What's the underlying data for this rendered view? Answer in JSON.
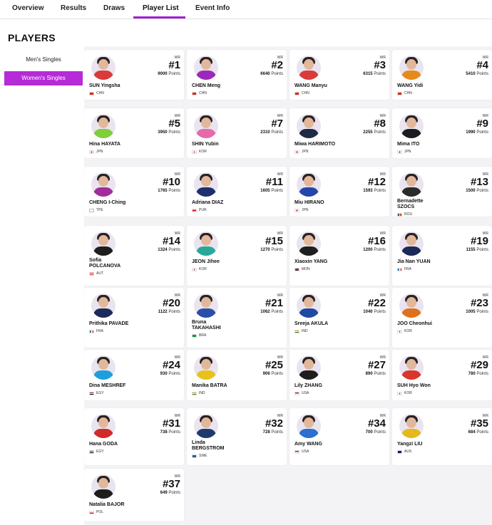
{
  "nav": {
    "tabs": [
      {
        "label": "Overview",
        "active": false
      },
      {
        "label": "Results",
        "active": false
      },
      {
        "label": "Draws",
        "active": false
      },
      {
        "label": "Player List",
        "active": true
      },
      {
        "label": "Event Info",
        "active": false
      }
    ]
  },
  "page_title": "PLAYERS",
  "sidebar": {
    "items": [
      {
        "label": "Men's Singles",
        "active": false
      },
      {
        "label": "Women's Singles",
        "active": true
      }
    ]
  },
  "wr_label": "WR",
  "points_label": "Points",
  "colors": {
    "accent": "#b52bd8",
    "tab_underline": "#a21cd1"
  },
  "players": [
    {
      "name": "SUN Yingsha",
      "rank": "#1",
      "points": "9000",
      "country": "CHN",
      "flag": "flag-chn",
      "shirt": "#d93b3b"
    },
    {
      "name": "CHEN Meng",
      "rank": "#2",
      "points": "6640",
      "country": "CHN",
      "flag": "flag-chn",
      "shirt": "#9b2ab8"
    },
    {
      "name": "WANG Manyu",
      "rank": "#3",
      "points": "6315",
      "country": "CHN",
      "flag": "flag-chn",
      "shirt": "#d93b3b"
    },
    {
      "name": "WANG Yidi",
      "rank": "#4",
      "points": "5410",
      "country": "CHN",
      "flag": "flag-chn",
      "shirt": "#e88a1a"
    },
    {
      "name": "Hina HAYATA",
      "rank": "#5",
      "points": "3950",
      "country": "JPN",
      "flag": "flag-jpn",
      "shirt": "#7fcf3a"
    },
    {
      "name": "SHIN Yubin",
      "rank": "#7",
      "points": "2310",
      "country": "KOR",
      "flag": "flag-kor",
      "shirt": "#e46aa8"
    },
    {
      "name": "Miwa HARIMOTO",
      "rank": "#8",
      "points": "2255",
      "country": "JPN",
      "flag": "flag-jpn",
      "shirt": "#1f2a44"
    },
    {
      "name": "Mima ITO",
      "rank": "#9",
      "points": "1990",
      "country": "JPN",
      "flag": "flag-jpn",
      "shirt": "#1c1c1c"
    },
    {
      "name": "CHENG I-Ching",
      "rank": "#10",
      "points": "1765",
      "country": "TPE",
      "flag": "flag-tpe",
      "shirt": "#a12d9c"
    },
    {
      "name": "Adriana DIAZ",
      "rank": "#11",
      "points": "1605",
      "country": "PUR",
      "flag": "flag-pur",
      "shirt": "#1f2f6e"
    },
    {
      "name": "Miu HIRANO",
      "rank": "#12",
      "points": "1593",
      "country": "JPN",
      "flag": "flag-jpn",
      "shirt": "#2446a8"
    },
    {
      "name": "Bernadette\nSZOCS",
      "rank": "#13",
      "points": "1500",
      "country": "ROU",
      "flag": "flag-rou",
      "shirt": "#2a2a2a"
    },
    {
      "name": "Sofia\nPOLCANOVA",
      "rank": "#14",
      "points": "1324",
      "country": "AUT",
      "flag": "flag-aut",
      "shirt": "#1e1e1e"
    },
    {
      "name": "JEON Jihee",
      "rank": "#15",
      "points": "1270",
      "country": "KOR",
      "flag": "flag-kor",
      "shirt": "#2aa79b"
    },
    {
      "name": "Xiaoxin YANG",
      "rank": "#16",
      "points": "1200",
      "country": "MON",
      "flag": "flag-mon",
      "shirt": "#1e1e1e"
    },
    {
      "name": "Jia Nan YUAN",
      "rank": "#19",
      "points": "1155",
      "country": "FRA",
      "flag": "flag-fra",
      "shirt": "#1c2a5a"
    },
    {
      "name": "Prithika PAVADE",
      "rank": "#20",
      "points": "1122",
      "country": "FRA",
      "flag": "flag-fra",
      "shirt": "#1c2a5a"
    },
    {
      "name": "Bruna\nTAKAHASHI",
      "rank": "#21",
      "points": "1062",
      "country": "BRA",
      "flag": "flag-bra",
      "shirt": "#2b4fa8"
    },
    {
      "name": "Sreeja AKULA",
      "rank": "#22",
      "points": "1040",
      "country": "IND",
      "flag": "flag-ind",
      "shirt": "#1f4aa3"
    },
    {
      "name": "JOO Cheonhui",
      "rank": "#23",
      "points": "1005",
      "country": "KOR",
      "flag": "flag-kor",
      "shirt": "#e0701c"
    },
    {
      "name": "Dina MESHREF",
      "rank": "#24",
      "points": "930",
      "country": "EGY",
      "flag": "flag-egy",
      "shirt": "#1f9fd9"
    },
    {
      "name": "Manika BATRA",
      "rank": "#25",
      "points": "906",
      "country": "IND",
      "flag": "flag-ind",
      "shirt": "#e8c21a"
    },
    {
      "name": "Lily ZHANG",
      "rank": "#27",
      "points": "890",
      "country": "USA",
      "flag": "flag-usa",
      "shirt": "#1e1e1e"
    },
    {
      "name": "SUH Hyo Won",
      "rank": "#29",
      "points": "780",
      "country": "KOR",
      "flag": "flag-kor",
      "shirt": "#d9362e"
    },
    {
      "name": "Hana GODA",
      "rank": "#31",
      "points": "738",
      "country": "EGY",
      "flag": "flag-egy",
      "shirt": "#d12a2a"
    },
    {
      "name": "Linda\nBERGSTROM",
      "rank": "#32",
      "points": "728",
      "country": "SWE",
      "flag": "flag-swe",
      "shirt": "#1f3a6e"
    },
    {
      "name": "Amy WANG",
      "rank": "#34",
      "points": "700",
      "country": "USA",
      "flag": "flag-usa",
      "shirt": "#2a6fd1"
    },
    {
      "name": "Yangzi LIU",
      "rank": "#35",
      "points": "684",
      "country": "AUS",
      "flag": "flag-aus",
      "shirt": "#e6b81c"
    },
    {
      "name": "Natalia BAJOR",
      "rank": "#37",
      "points": "649",
      "country": "POL",
      "flag": "flag-pol",
      "shirt": "#1e1e1e"
    }
  ]
}
